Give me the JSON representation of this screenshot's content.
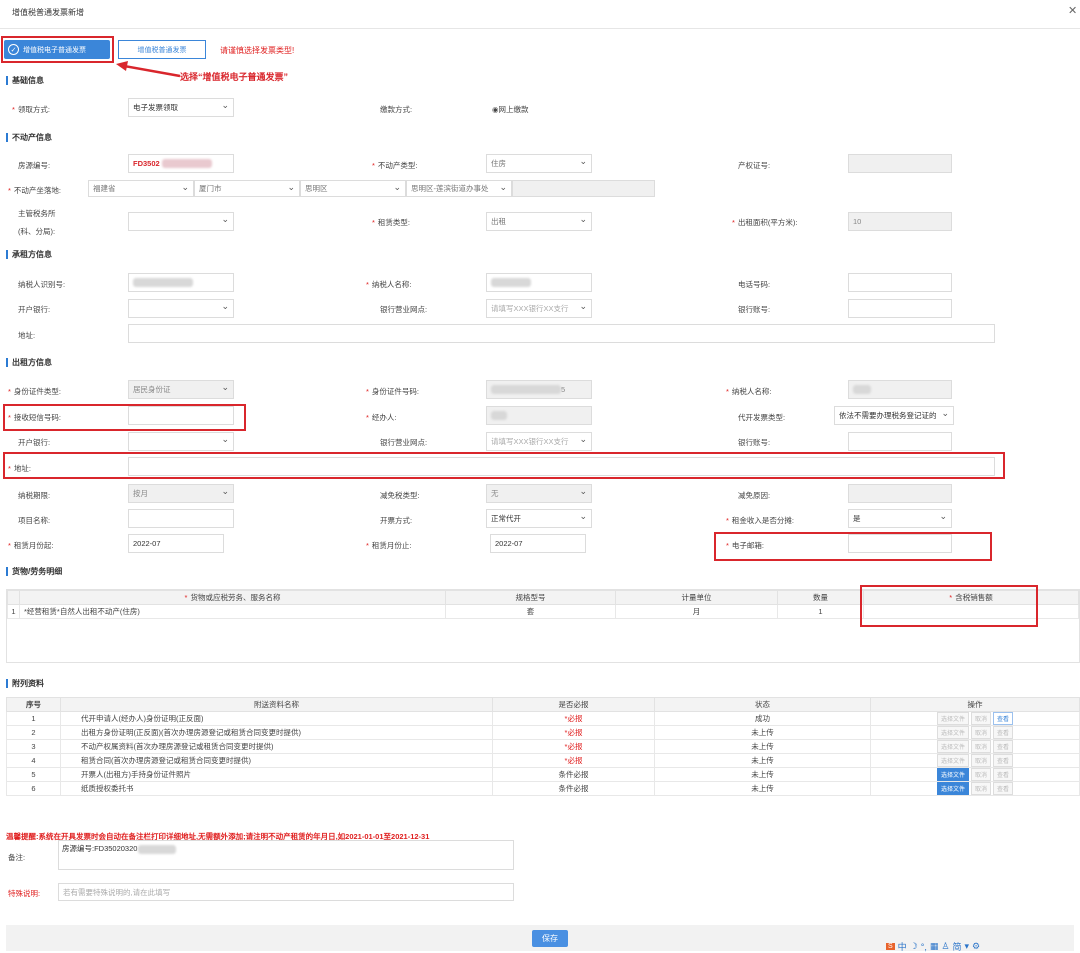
{
  "dialog": {
    "title": "增值税普通发票新增",
    "close_icon": "close-icon"
  },
  "invoice_type": {
    "selected_tab": "增值税电子普通发票",
    "other_tab": "增值税普通发票",
    "hint": "请谨慎选择发票类型!",
    "annotation": "选择“增值税电子普通发票”"
  },
  "basic": {
    "section": "基础信息",
    "receive_label": "领取方式:",
    "receive_value": "电子发票领取",
    "pay_label": "缴款方式:",
    "pay_value": "网上缴款"
  },
  "property": {
    "section": "不动产信息",
    "house_no_label": "房源编号:",
    "house_no_value": "FD3502",
    "type_label": "不动产类型:",
    "type_value": "住房",
    "cert_label": "产权证号:",
    "location_label": "不动产坐落地:",
    "loc_province": "福建省",
    "loc_city": "厦门市",
    "loc_district": "思明区",
    "loc_street": "思明区-莲滨街道办事处",
    "tax_office_label_1": "主管税务所",
    "tax_office_label_2": "(科、分局):",
    "lease_type_label": "租赁类型:",
    "lease_type_value": "出租",
    "area_label": "出租面积(平方米):",
    "area_value": "10"
  },
  "lessee": {
    "section": "承租方信息",
    "taxid_label": "纳税人识别号:",
    "name_label": "纳税人名称:",
    "phone_label": "电话号码:",
    "bank_label": "开户银行:",
    "branch_label": "银行营业网点:",
    "branch_placeholder": "请填写XXX银行XX支行",
    "account_label": "银行账号:",
    "address_label": "地址:"
  },
  "lessor": {
    "section": "出租方信息",
    "idtype_label": "身份证件类型:",
    "idtype_value": "居民身份证",
    "idno_label": "身份证件号码:",
    "idno_tail": "5",
    "name_label": "纳税人名称:",
    "sms_label": "接收短信号码:",
    "agent_label": "经办人:",
    "agent_type_label": "代开发票类型:",
    "agent_type_value": "依法不需要办理税务登记证的",
    "bank_label": "开户银行:",
    "branch_label": "银行营业网点:",
    "branch_placeholder": "请填写XXX银行XX支行",
    "account_label": "银行账号:",
    "address_label": "地址:",
    "period_label": "纳税期限:",
    "period_value": "按月",
    "relief_type_label": "减免税类型:",
    "relief_type_value": "无",
    "relief_reason_label": "减免原因:",
    "project_label": "项目名称:",
    "issue_method_label": "开票方式:",
    "issue_method_value": "正常代开",
    "split_label": "租金收入是否分摊:",
    "split_value": "是",
    "start_label": "租赁月份起:",
    "start_value": "2022-07",
    "end_label": "租赁月份止:",
    "end_value": "2022-07",
    "email_label": "电子邮箱:"
  },
  "goods": {
    "section": "货物/劳务明细",
    "headers": [
      "货物或应税劳务、服务名称",
      "规格型号",
      "计量单位",
      "数量",
      "含税销售额"
    ],
    "row": {
      "no": "1",
      "name": "*经营租赁*自然人出租不动产(住房)",
      "spec": "套",
      "unit": "月",
      "qty": "1",
      "amount": ""
    }
  },
  "attachments": {
    "section": "附列资料",
    "headers": [
      "序号",
      "附送资料名称",
      "是否必报",
      "状态",
      "操作"
    ],
    "btn_select": "选择文件",
    "btn_cancel": "取消",
    "btn_view": "查看",
    "rows": [
      {
        "no": "1",
        "name": "代开申请人(经办人)身份证明(正反面)",
        "req": "*必报",
        "status": "成功"
      },
      {
        "no": "2",
        "name": "出租方身份证明(正反面)(首次办理房源登记或租赁合同变更时提供)",
        "req": "*必报",
        "status": "未上传"
      },
      {
        "no": "3",
        "name": "不动产权属资料(首次办理房源登记或租赁合同变更时提供)",
        "req": "*必报",
        "status": "未上传"
      },
      {
        "no": "4",
        "name": "租赁合同(首次办理房源登记或租赁合同变更时提供)",
        "req": "*必报",
        "status": "未上传"
      },
      {
        "no": "5",
        "name": "开票人(出租方)手持身份证件照片",
        "req": "条件必报",
        "status": "未上传"
      },
      {
        "no": "6",
        "name": "纸质授权委托书",
        "req": "条件必报",
        "status": "未上传"
      }
    ]
  },
  "notes": {
    "warning": "温馨提醒:系统在开具发票时会自动在备注栏打印详细地址,无需额外添加;请注明不动产租赁的年月日,如2021-01-01至2021-12-31",
    "remark_label": "备注:",
    "remark_value": "房源编号:FD35020320",
    "special_label": "特殊说明:",
    "special_placeholder": "若有需要特殊说明的,请在此填写"
  },
  "footer": {
    "save": "保存",
    "ime": [
      "中",
      "简"
    ]
  },
  "colors": {
    "accent": "#3b86d9",
    "required": "#e02020",
    "highlight_box": "#d9262c"
  }
}
